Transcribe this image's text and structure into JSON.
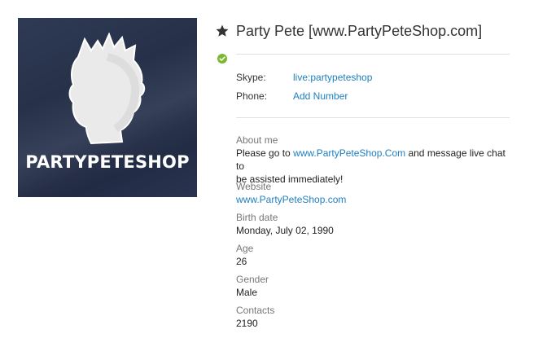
{
  "avatar": {
    "brand_text": "PARTYPETESHOP"
  },
  "header": {
    "display_name": "Party Pete [www.PartyPeteShop.com]",
    "favorite_icon": "star-icon",
    "status_icon": "online-status-check-icon"
  },
  "contact": {
    "skype_label": "Skype:",
    "skype_value": "live:partypeteshop",
    "phone_label": "Phone:",
    "phone_action": "Add Number"
  },
  "profile": {
    "about_label": "About me",
    "about_prefix": "Please go to ",
    "about_link": "www.PartyPeteShop.Com",
    "about_suffix_1": " and message live chat to",
    "about_suffix_2": "be assisted immediately!",
    "website_label": "Website",
    "website_value": "www.PartyPeteShop.com",
    "birth_label": "Birth date",
    "birth_value": "Monday, July 02, 1990",
    "age_label": "Age",
    "age_value": "26",
    "gender_label": "Gender",
    "gender_value": "Male",
    "contacts_label": "Contacts",
    "contacts_value": "2190"
  },
  "colors": {
    "link": "#1e7fbf",
    "status_green": "#7cb82f",
    "divider": "#e1e1e1"
  }
}
